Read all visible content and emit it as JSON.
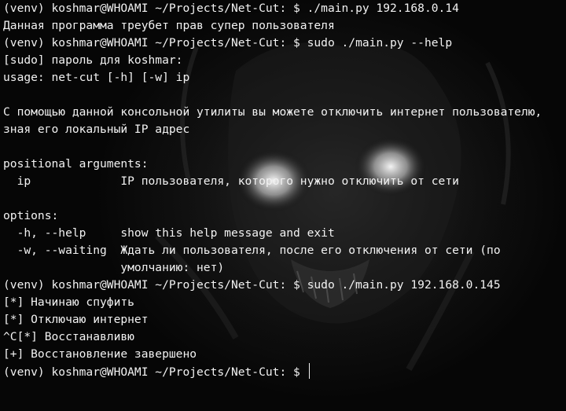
{
  "terminal": {
    "lines": [
      "(venv) koshmar@WHOAMI ~/Projects/Net-Cut: $ ./main.py 192.168.0.14",
      "Данная программа треубет прав супер пользователя",
      "(venv) koshmar@WHOAMI ~/Projects/Net-Cut: $ sudo ./main.py --help",
      "[sudo] пароль для koshmar:",
      "usage: net-cut [-h] [-w] ip",
      "",
      "С помощью данной консольной утилиты вы можете отключить интернет пользователю,",
      "зная его локальный IP адрес",
      "",
      "positional arguments:",
      "  ip             IP пользователя, которого нужно отключить от сети",
      "",
      "options:",
      "  -h, --help     show this help message and exit",
      "  -w, --waiting  Ждать ли пользователя, после его отключения от сети (по",
      "                 умолчанию: нет)",
      "(venv) koshmar@WHOAMI ~/Projects/Net-Cut: $ sudo ./main.py 192.168.0.145",
      "[*] Начинаю спуфить",
      "[*] Отключаю интернет",
      "^C[*] Восстанавливю",
      "[+] Восстановление завершено"
    ],
    "prompt": "(venv) koshmar@WHOAMI ~/Projects/Net-Cut: $ "
  },
  "colors": {
    "background": "#000000",
    "text": "#f2f2f2"
  }
}
